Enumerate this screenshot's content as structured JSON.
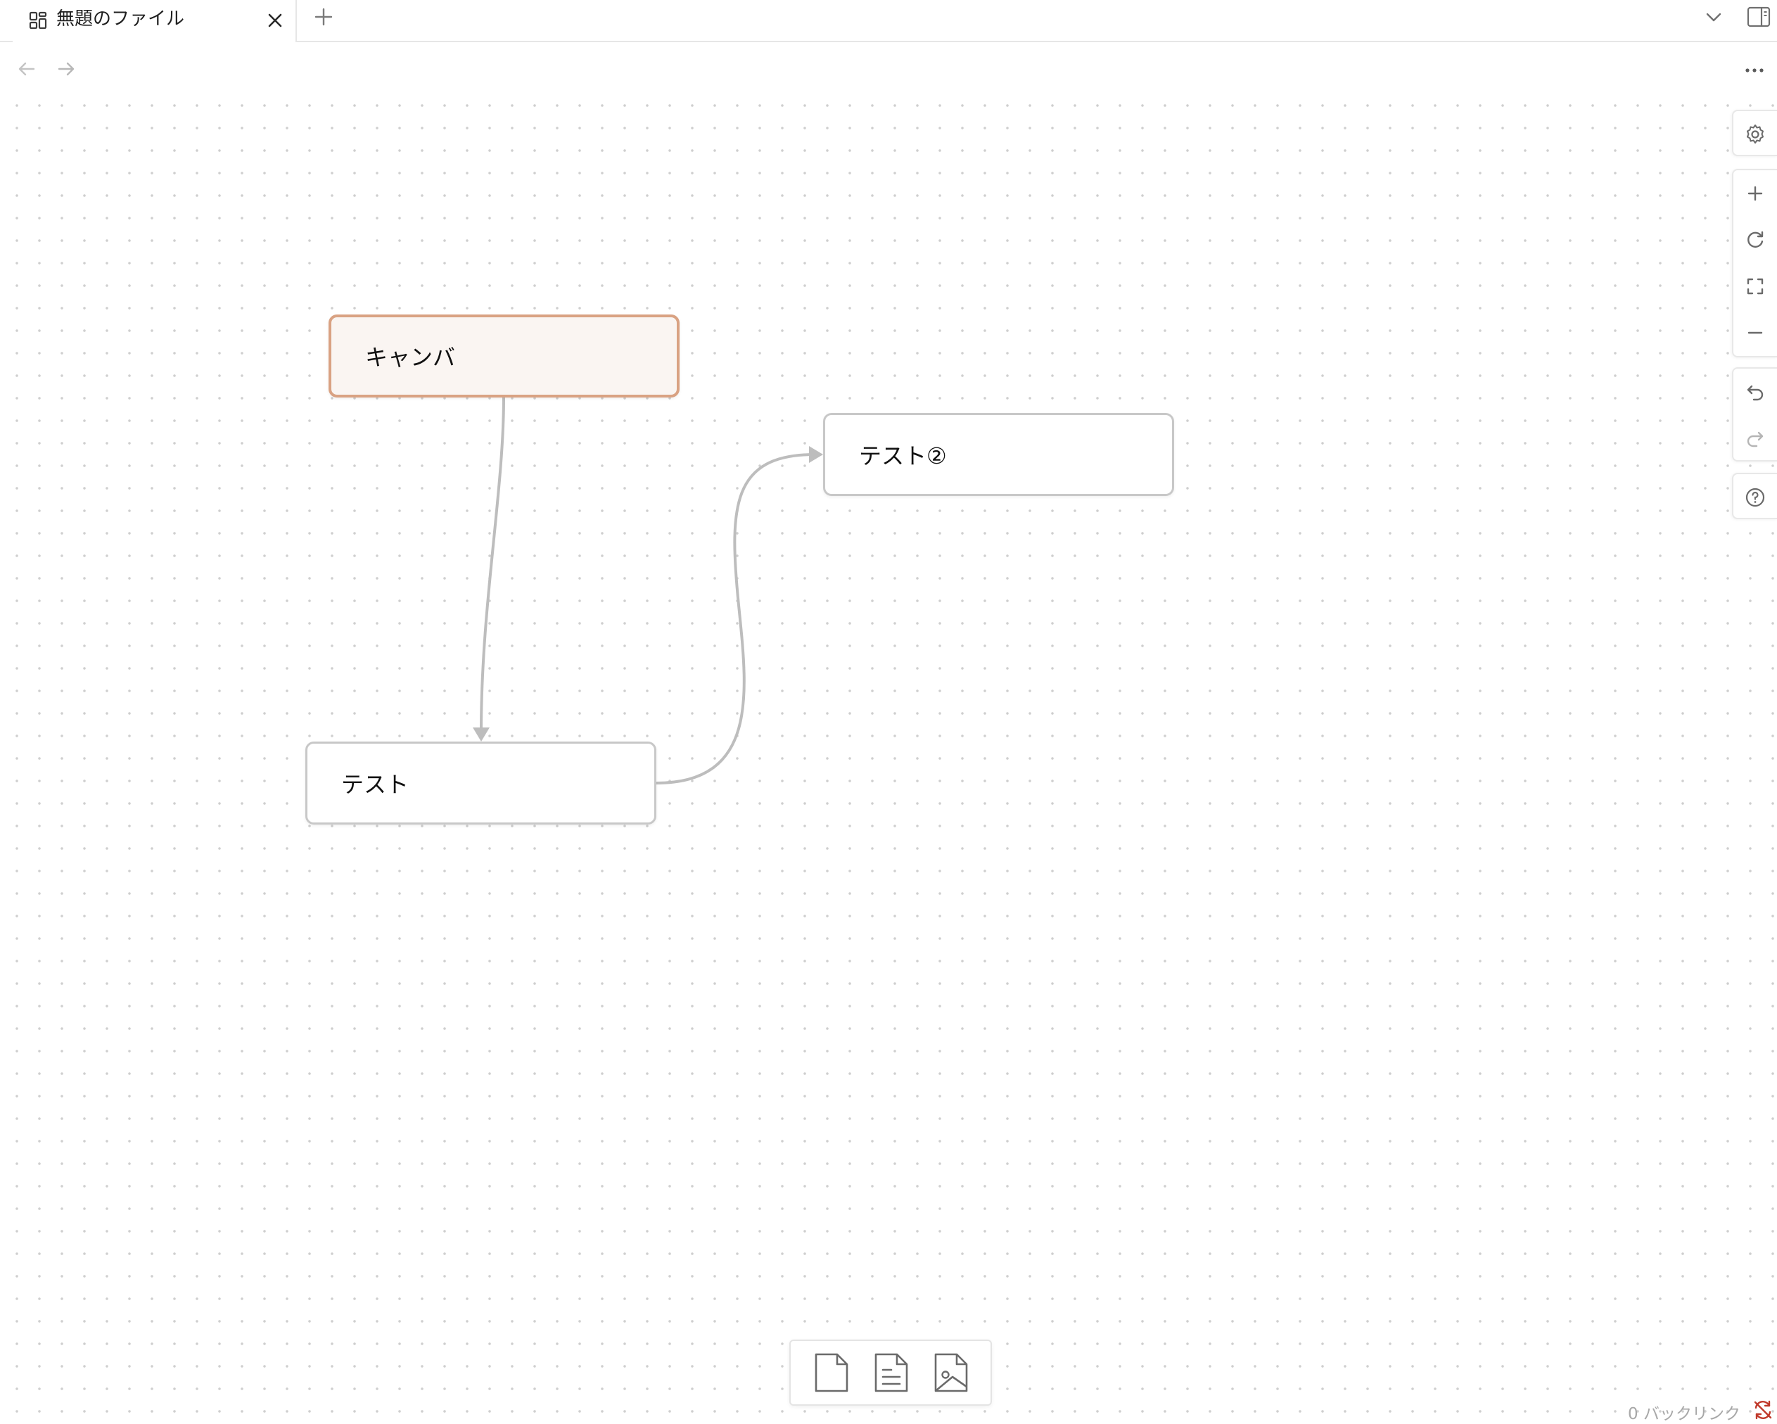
{
  "tab": {
    "title": "無題のファイル",
    "icon": "canvas-icon"
  },
  "canvas": {
    "nodes": [
      {
        "id": "node-1",
        "text": "キャンバ",
        "selected": true
      },
      {
        "id": "node-2",
        "text": "テスト②",
        "selected": false
      },
      {
        "id": "node-3",
        "text": "テスト",
        "selected": false
      }
    ],
    "edges": [
      {
        "from": "キャンバ",
        "to": "テスト"
      },
      {
        "from": "テスト",
        "to": "テスト②"
      }
    ]
  },
  "controls": {
    "icons": [
      "gear-icon",
      "zoom-in-icon",
      "reset-zoom-icon",
      "zoom-to-fit-icon",
      "zoom-out-icon",
      "undo-icon",
      "redo-icon",
      "help-icon"
    ]
  },
  "toolbar": {
    "icons": [
      "add-card-icon",
      "add-note-icon",
      "add-media-icon"
    ]
  },
  "status": {
    "backlinks": "0 バックリンク"
  },
  "colors": {
    "selected_border": "#d9a283",
    "selected_fill": "#faf5f2",
    "node_border": "#c8c8c8",
    "edge": "#bdbdbd",
    "sync_error": "#c0392b"
  }
}
